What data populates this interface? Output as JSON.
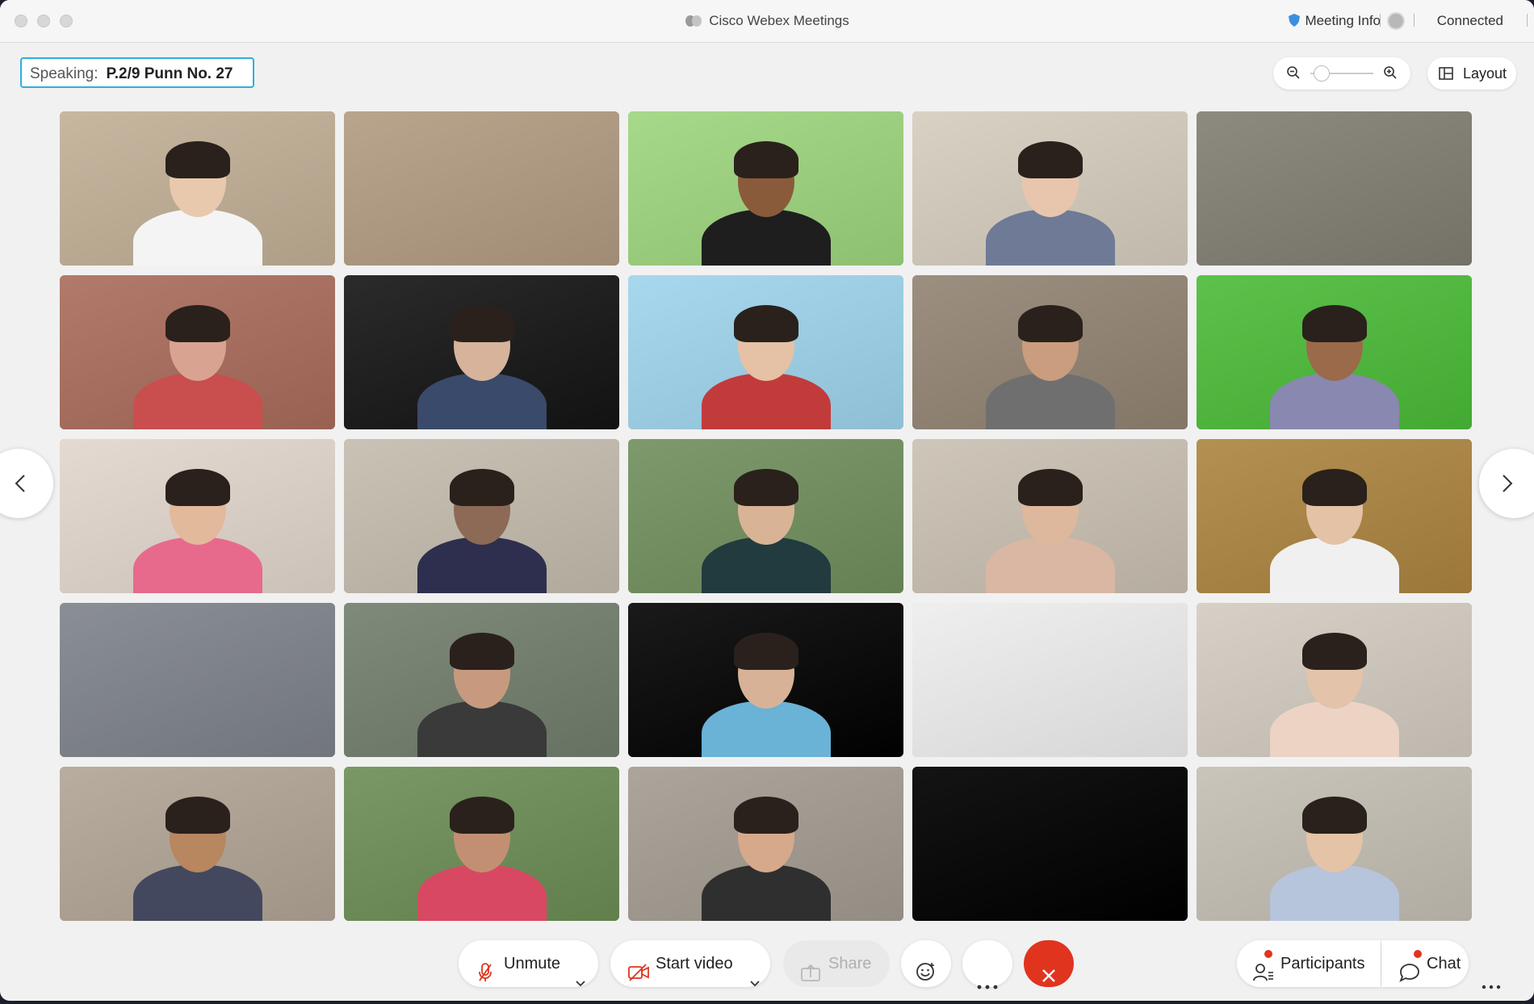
{
  "window": {
    "title": "Cisco Webex Meetings",
    "meeting_info_label": "Meeting Info",
    "status": "Connected"
  },
  "speaking": {
    "label": "Speaking:",
    "name": "P.2/9 Punn No. 27"
  },
  "view": {
    "layout_label": "Layout",
    "zoom_level": 0.05
  },
  "controls": {
    "unmute_label": "Unmute",
    "start_video_label": "Start video",
    "share_label": "Share",
    "participants_label": "Participants",
    "chat_label": "Chat"
  },
  "colors": {
    "accent": "#2bb0e0",
    "leave": "#e0341e",
    "notification": "#e0341e"
  },
  "icons": [
    "shield-icon",
    "zoom-out-icon",
    "zoom-in-icon",
    "grid-layout-icon",
    "chevron-left-icon",
    "chevron-right-icon",
    "mic-muted-icon",
    "video-off-icon",
    "share-icon",
    "smiley-icon",
    "more-icon",
    "close-icon",
    "participants-icon",
    "chat-icon"
  ],
  "participants": [
    {
      "bg": "#c8b7a0",
      "skin": "#e8c9ad",
      "shirt": "#f4f4f4"
    },
    {
      "bg": "#b9a58d",
      "skin": null,
      "shirt": null
    },
    {
      "bg": "#a7d98a",
      "skin": "#8a5b3a",
      "shirt": "#1e1e1e"
    },
    {
      "bg": "#d9d2c4",
      "skin": "#e8c6ad",
      "shirt": "#6f7a96"
    },
    {
      "bg": "#8d8a80",
      "skin": null,
      "shirt": null
    },
    {
      "bg": "#b27a6b",
      "skin": "#d9a392",
      "shirt": "#c94e4e"
    },
    {
      "bg": "#2b2b2b",
      "skin": "#d6b39a",
      "shirt": "#3a4a6a"
    },
    {
      "bg": "#a8d8ee",
      "skin": "#e5c1a6",
      "shirt": "#c23b3b"
    },
    {
      "bg": "#9c8f80",
      "skin": "#c99d7d",
      "shirt": "#6f6f6f"
    },
    {
      "bg": "#5cc24b",
      "skin": "#9a6a4a",
      "shirt": "#8888b0"
    },
    {
      "bg": "#e4dad2",
      "skin": "#e2b99b",
      "shirt": "#e76a8c"
    },
    {
      "bg": "#c9c2b5",
      "skin": "#8d6a55",
      "shirt": "#2e2e4e"
    },
    {
      "bg": "#7e9a6d",
      "skin": "#d9b395",
      "shirt": "#223b3e"
    },
    {
      "bg": "#cfc6ba",
      "skin": "#ddb89d",
      "shirt": "#d9b7a2"
    },
    {
      "bg": "#b49052",
      "skin": "#e4c2a6",
      "shirt": "#f0f0f0"
    },
    {
      "bg": "#8a8f95",
      "skin": null,
      "shirt": null
    },
    {
      "bg": "#7f8a7a",
      "skin": "#c79a80",
      "shirt": "#3a3a3a"
    },
    {
      "bg": "#1a1a1a",
      "skin": "#d8b296",
      "shirt": "#6ab2d6"
    },
    {
      "bg": "#efefef",
      "skin": null,
      "shirt": null
    },
    {
      "bg": "#d6d0c6",
      "skin": "#e3c3a9",
      "shirt": "#ecd3c4"
    },
    {
      "bg": "#b9ada0",
      "skin": "#b8865f",
      "shirt": "#43485e"
    },
    {
      "bg": "#7a9866",
      "skin": "#c28f72",
      "shirt": "#d94862"
    },
    {
      "bg": "#aca59b",
      "skin": "#d6a98b",
      "shirt": "#2f2f2f"
    },
    {
      "bg": "#141414",
      "skin": null,
      "shirt": null
    },
    {
      "bg": "#c9c5bb",
      "skin": "#e4c3a6",
      "shirt": "#b6c4dc"
    }
  ]
}
